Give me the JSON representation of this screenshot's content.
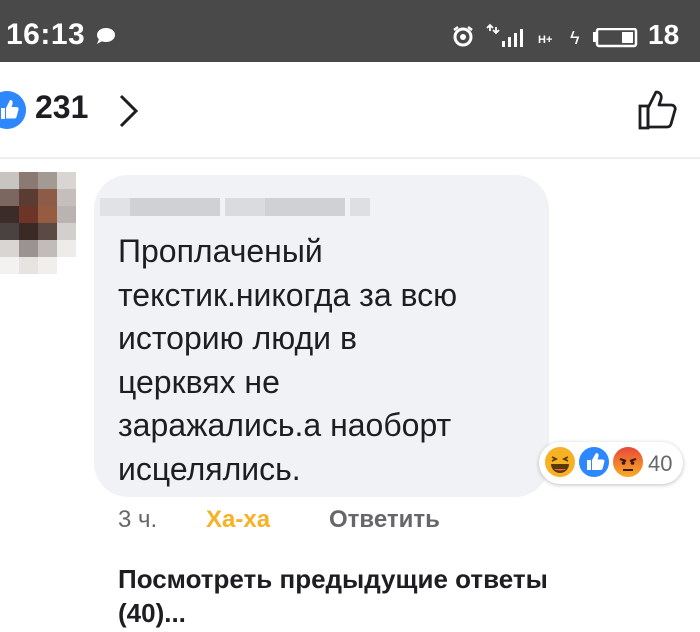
{
  "status_bar": {
    "time": "16:13",
    "network_label": "H+",
    "battery_percent": "18",
    "icons": [
      "chat-bubble-icon",
      "alarm-icon",
      "signal-icon",
      "charging-bolt-icon",
      "battery-icon"
    ]
  },
  "reactions_header": {
    "like_count": "231",
    "icons": [
      "like-badge-icon",
      "chevron-right-icon",
      "thumbs-up-outline-icon"
    ]
  },
  "comment": {
    "author_name_blurred": true,
    "text": "Проплаченый\nтекстик.никогда за всю\nисторию люди в\nцерквях не\nзаражались.а наоборт\nисцелялись.",
    "reactions": {
      "emojis": [
        "haha-emoji-icon",
        "like-emoji-icon",
        "angry-emoji-icon"
      ],
      "count": "40"
    },
    "actions": {
      "time": "3 ч.",
      "reaction_label": "Ха-ха",
      "reply_label": "Ответить"
    },
    "view_previous_replies": "Посмотреть предыдущие ответы (40)..."
  },
  "colors": {
    "status_bar_bg": "#494949",
    "bubble_bg": "#f0f2f5",
    "facebook_blue": "#2d88ff",
    "haha_yellow": "#f7b125",
    "angry_orange": "#f0603c",
    "secondary_text": "#65676b"
  }
}
